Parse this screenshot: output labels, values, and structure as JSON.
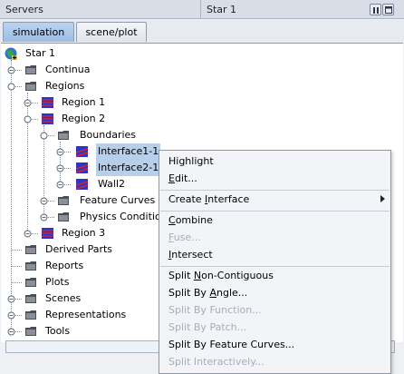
{
  "window": {
    "left_title": "Servers",
    "right_title": "Star 1"
  },
  "tabs": [
    {
      "label": "simulation"
    },
    {
      "label": "scene/plot"
    }
  ],
  "tree": {
    "root": "Star 1",
    "continua": "Continua",
    "regions": "Regions",
    "region1": "Region 1",
    "region2": "Region 2",
    "boundaries": "Boundaries",
    "interface1": "Interface1-1",
    "interface2": "Interface2-1",
    "wall2": "Wall2",
    "feature_curves": "Feature Curves",
    "physics_conditions": "Physics Conditio",
    "region3": "Region 3",
    "derived_parts": "Derived Parts",
    "reports": "Reports",
    "plots": "Plots",
    "scenes": "Scenes",
    "representations": "Representations",
    "tools": "Tools"
  },
  "context_menu": {
    "highlight": {
      "pre": "",
      "u": "",
      "post": "Highlight"
    },
    "edit": {
      "pre": "",
      "u": "E",
      "post": "dit..."
    },
    "create_interface": {
      "pre": "Create ",
      "u": "I",
      "post": "nterface"
    },
    "combine": {
      "pre": "",
      "u": "C",
      "post": "ombine"
    },
    "fuse": {
      "pre": "",
      "u": "F",
      "post": "use..."
    },
    "intersect": {
      "pre": "",
      "u": "I",
      "post": "ntersect"
    },
    "split_non_contiguous": {
      "pre": "Split ",
      "u": "N",
      "post": "on-Contiguous"
    },
    "split_by_angle": {
      "pre": "Split By ",
      "u": "A",
      "post": "ngle..."
    },
    "split_by_function": {
      "pre": "Split By Function...",
      "u": "",
      "post": ""
    },
    "split_by_patch": {
      "pre": "Split By Patch...",
      "u": "",
      "post": ""
    },
    "split_by_feature_curves": {
      "pre": "Split By Feature Curves...",
      "u": "",
      "post": ""
    },
    "split_interactively": {
      "pre": "Split Interactively...",
      "u": "",
      "post": ""
    }
  },
  "colors": {
    "selection": "#b8cfe9",
    "tab_active": "#9cbde6",
    "folder": "#4b4f55",
    "boundary_blue": "#2a36c8",
    "boundary_red": "#e02020"
  }
}
